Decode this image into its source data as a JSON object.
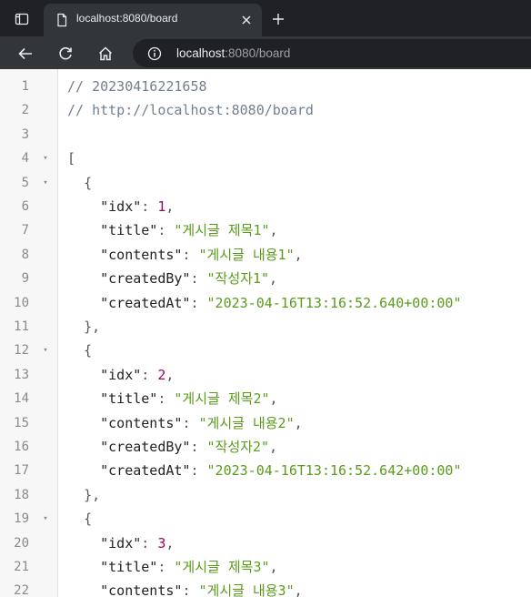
{
  "browser": {
    "tab_title": "localhost:8080/board",
    "url_host": "localhost",
    "url_path": ":8080/board",
    "colors": {
      "frame": "#202124",
      "toolbar": "#323639",
      "accent_text": "#e8eaed"
    }
  },
  "code": {
    "colors": {
      "comment": "#708090",
      "number": "#a0005a",
      "string": "#5a9b1c"
    },
    "lines": [
      {
        "n": "1",
        "fold": false,
        "indent": "",
        "tokens": [
          {
            "t": "// 20230416221658",
            "c": "comment"
          }
        ]
      },
      {
        "n": "2",
        "fold": false,
        "indent": "",
        "tokens": [
          {
            "t": "// http://localhost:8080/board",
            "c": "comment"
          }
        ]
      },
      {
        "n": "3",
        "fold": false,
        "indent": "",
        "tokens": []
      },
      {
        "n": "4",
        "fold": true,
        "indent": "",
        "tokens": [
          {
            "t": "[",
            "c": "punct"
          }
        ]
      },
      {
        "n": "5",
        "fold": true,
        "indent": "  ",
        "tokens": [
          {
            "t": "{",
            "c": "punct"
          }
        ]
      },
      {
        "n": "6",
        "fold": false,
        "indent": "    ",
        "tokens": [
          {
            "t": "\"idx\"",
            "c": "key"
          },
          {
            "t": ": ",
            "c": "punct"
          },
          {
            "t": "1",
            "c": "num"
          },
          {
            "t": ",",
            "c": "punct"
          }
        ]
      },
      {
        "n": "7",
        "fold": false,
        "indent": "    ",
        "tokens": [
          {
            "t": "\"title\"",
            "c": "key"
          },
          {
            "t": ": ",
            "c": "punct"
          },
          {
            "t": "\"게시글 제목1\"",
            "c": "str"
          },
          {
            "t": ",",
            "c": "punct"
          }
        ]
      },
      {
        "n": "8",
        "fold": false,
        "indent": "    ",
        "tokens": [
          {
            "t": "\"contents\"",
            "c": "key"
          },
          {
            "t": ": ",
            "c": "punct"
          },
          {
            "t": "\"게시글 내용1\"",
            "c": "str"
          },
          {
            "t": ",",
            "c": "punct"
          }
        ]
      },
      {
        "n": "9",
        "fold": false,
        "indent": "    ",
        "tokens": [
          {
            "t": "\"createdBy\"",
            "c": "key"
          },
          {
            "t": ": ",
            "c": "punct"
          },
          {
            "t": "\"작성자1\"",
            "c": "str"
          },
          {
            "t": ",",
            "c": "punct"
          }
        ]
      },
      {
        "n": "10",
        "fold": false,
        "indent": "    ",
        "tokens": [
          {
            "t": "\"createdAt\"",
            "c": "key"
          },
          {
            "t": ": ",
            "c": "punct"
          },
          {
            "t": "\"2023-04-16T13:16:52.640+00:00\"",
            "c": "str"
          }
        ]
      },
      {
        "n": "11",
        "fold": false,
        "indent": "  ",
        "tokens": [
          {
            "t": "},",
            "c": "punct"
          }
        ]
      },
      {
        "n": "12",
        "fold": true,
        "indent": "  ",
        "tokens": [
          {
            "t": "{",
            "c": "punct"
          }
        ]
      },
      {
        "n": "13",
        "fold": false,
        "indent": "    ",
        "tokens": [
          {
            "t": "\"idx\"",
            "c": "key"
          },
          {
            "t": ": ",
            "c": "punct"
          },
          {
            "t": "2",
            "c": "num"
          },
          {
            "t": ",",
            "c": "punct"
          }
        ]
      },
      {
        "n": "14",
        "fold": false,
        "indent": "    ",
        "tokens": [
          {
            "t": "\"title\"",
            "c": "key"
          },
          {
            "t": ": ",
            "c": "punct"
          },
          {
            "t": "\"게시글 제목2\"",
            "c": "str"
          },
          {
            "t": ",",
            "c": "punct"
          }
        ]
      },
      {
        "n": "15",
        "fold": false,
        "indent": "    ",
        "tokens": [
          {
            "t": "\"contents\"",
            "c": "key"
          },
          {
            "t": ": ",
            "c": "punct"
          },
          {
            "t": "\"게시글 내용2\"",
            "c": "str"
          },
          {
            "t": ",",
            "c": "punct"
          }
        ]
      },
      {
        "n": "16",
        "fold": false,
        "indent": "    ",
        "tokens": [
          {
            "t": "\"createdBy\"",
            "c": "key"
          },
          {
            "t": ": ",
            "c": "punct"
          },
          {
            "t": "\"작성자2\"",
            "c": "str"
          },
          {
            "t": ",",
            "c": "punct"
          }
        ]
      },
      {
        "n": "17",
        "fold": false,
        "indent": "    ",
        "tokens": [
          {
            "t": "\"createdAt\"",
            "c": "key"
          },
          {
            "t": ": ",
            "c": "punct"
          },
          {
            "t": "\"2023-04-16T13:16:52.642+00:00\"",
            "c": "str"
          }
        ]
      },
      {
        "n": "18",
        "fold": false,
        "indent": "  ",
        "tokens": [
          {
            "t": "},",
            "c": "punct"
          }
        ]
      },
      {
        "n": "19",
        "fold": true,
        "indent": "  ",
        "tokens": [
          {
            "t": "{",
            "c": "punct"
          }
        ]
      },
      {
        "n": "20",
        "fold": false,
        "indent": "    ",
        "tokens": [
          {
            "t": "\"idx\"",
            "c": "key"
          },
          {
            "t": ": ",
            "c": "punct"
          },
          {
            "t": "3",
            "c": "num"
          },
          {
            "t": ",",
            "c": "punct"
          }
        ]
      },
      {
        "n": "21",
        "fold": false,
        "indent": "    ",
        "tokens": [
          {
            "t": "\"title\"",
            "c": "key"
          },
          {
            "t": ": ",
            "c": "punct"
          },
          {
            "t": "\"게시글 제목3\"",
            "c": "str"
          },
          {
            "t": ",",
            "c": "punct"
          }
        ]
      },
      {
        "n": "22",
        "fold": false,
        "indent": "    ",
        "tokens": [
          {
            "t": "\"contents\"",
            "c": "key"
          },
          {
            "t": ": ",
            "c": "punct"
          },
          {
            "t": "\"게시글 내용3\"",
            "c": "str"
          },
          {
            "t": ",",
            "c": "punct"
          }
        ]
      }
    ]
  }
}
